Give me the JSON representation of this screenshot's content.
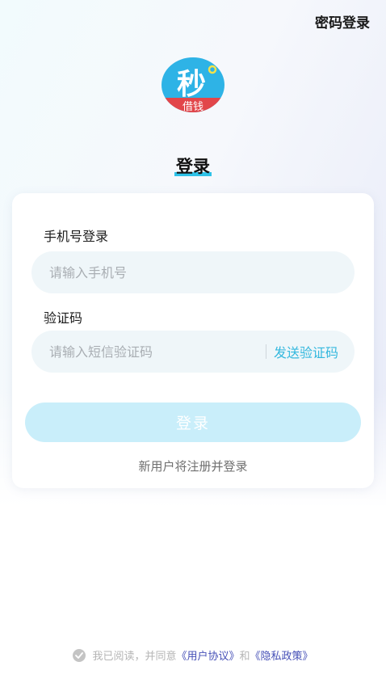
{
  "header": {
    "password_login": "密码登录"
  },
  "logo": {
    "char": "秒",
    "sub": "借钱",
    "brand_color": "#2eb3e6",
    "accent": "#e2464a"
  },
  "page_title": "登录",
  "phone": {
    "label": "手机号登录",
    "placeholder": "请输入手机号"
  },
  "code": {
    "label": "验证码",
    "placeholder": "请输入短信验证码",
    "send_label": "发送验证码"
  },
  "login_button": "登录",
  "register_hint": "新用户将注册并登录",
  "agreement": {
    "prefix": "我已阅读，并同意",
    "user_agreement": "《用户协议》",
    "and": "和",
    "privacy_policy": "《隐私政策》"
  }
}
